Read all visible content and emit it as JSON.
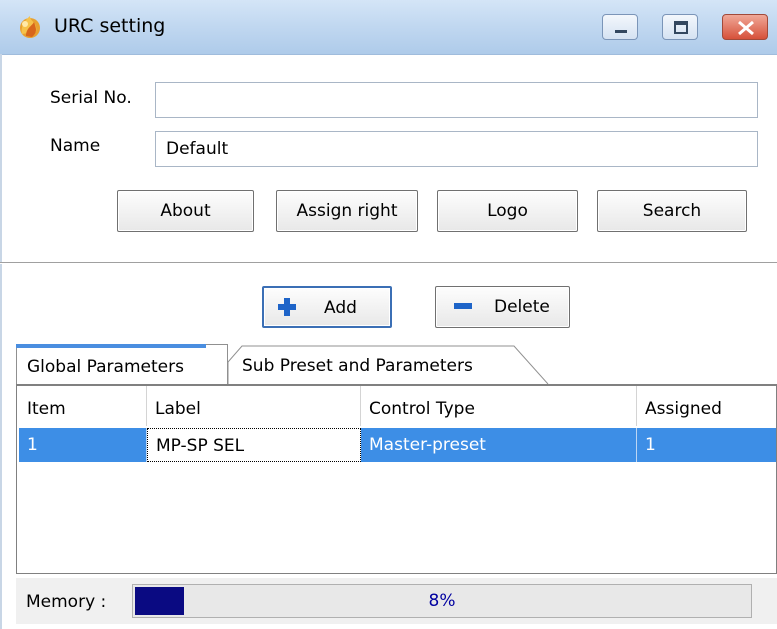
{
  "window": {
    "title": "URC setting",
    "icon": "app-flame-icon",
    "controls": [
      "minimize-icon",
      "maximize-icon",
      "close-icon"
    ]
  },
  "form": {
    "serial_label": "Serial No.",
    "serial_value": "",
    "name_label": "Name",
    "name_value": "Default"
  },
  "buttons": {
    "about": "About",
    "assign_right": "Assign right",
    "logo": "Logo",
    "search": "Search",
    "add": "Add",
    "delete": "Delete"
  },
  "tabs": [
    {
      "label": "Global Parameters",
      "active": true
    },
    {
      "label": "Sub Preset and Parameters",
      "active": false
    }
  ],
  "table": {
    "columns": [
      "Item",
      "Label",
      "Control Type",
      "Assigned"
    ],
    "rows": [
      {
        "item": "1",
        "label": "MP-SP SEL",
        "control_type": "Master-preset",
        "assigned": "1",
        "selected": true
      }
    ]
  },
  "status": {
    "memory_label": "Memory :",
    "memory_percent_text": "8%",
    "memory_fraction": 0.08
  },
  "colors": {
    "titlebar": "#c0d7f0",
    "selection": "#3d8ee6",
    "progress_fill": "#0a0a82",
    "add_icon": "#1e64c8",
    "delete_icon": "#1e64c8"
  }
}
